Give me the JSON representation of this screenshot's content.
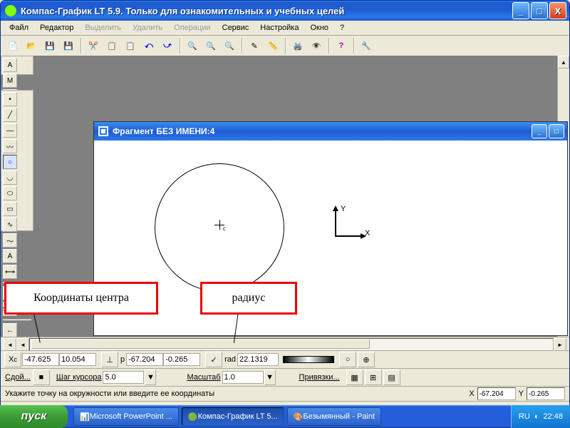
{
  "title": "Компас-График LT 5.9. Только для ознакомительных и учебных целей",
  "menu": {
    "file": "Файл",
    "edit": "Редактор",
    "select": "Выделить",
    "delete": "Удалить",
    "ops": "Операции",
    "service": "Сервис",
    "settings": "Настройка",
    "window": "Окно",
    "help": "?"
  },
  "doc": {
    "title": "Фрагмент БЕЗ ИМЕНИ:4"
  },
  "axis": {
    "x": "X",
    "y": "Y"
  },
  "annotation": {
    "coords": "Координаты центра",
    "radius": "радиус"
  },
  "coordbar": {
    "xc_label": "X",
    "c_label": "c",
    "xc": "-47.625",
    "yc": "10.054",
    "p_label": "p",
    "xp": "-67.204",
    "yp": "-0.265",
    "rad_label": "rad",
    "rad": "22.1319",
    "style_label": "Сдой...",
    "step_label": "Шаг курсора",
    "step": "5.0",
    "scale_label": "Масштаб",
    "scale": "1.0",
    "snaps": "Привязки..."
  },
  "status": {
    "msg": "Укажите точку на окружности или введите ее координаты",
    "X": "X",
    "Y": "Y",
    "xv": "-67.204",
    "yv": "-0.265"
  },
  "taskbar": {
    "start": "пуск",
    "t1": "Microsoft PowerPoint ...",
    "t2": "Компас-График LT 5...",
    "t3": "Безымянный - Paint",
    "lang": "RU",
    "time": "22:48"
  },
  "icons": {
    "min": "_",
    "max": "□",
    "close": "X",
    "left": "◄",
    "right": "►",
    "up": "▲",
    "down": "▼",
    "block": "■"
  }
}
